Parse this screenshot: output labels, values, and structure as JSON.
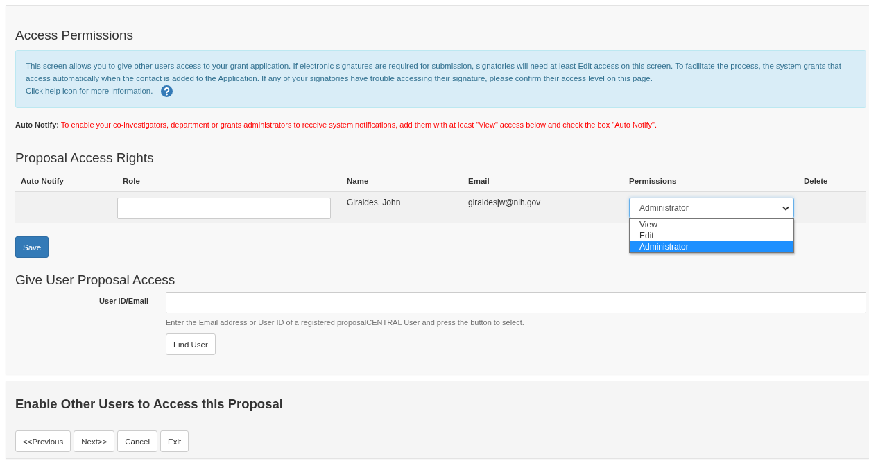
{
  "access_permissions": {
    "title": "Access Permissions",
    "info": "This screen allows you to give other users access to your grant application. If electronic signatures are required for submission, signatories will need at least Edit access on this screen. To facilitate the process, the system grants that access automatically when the contact is added to the Application. If any of your signatories have trouble accessing their signature, please confirm their access level on this page.",
    "help_text": "Click help icon for more information."
  },
  "auto_notify": {
    "label": "Auto Notify:",
    "text": "To enable your co-investigators, department or grants administrators to receive system notifications, add them with at least \"View\" access below and check the box \"Auto Notify\"."
  },
  "proposal_access_rights": {
    "title": "Proposal Access Rights",
    "columns": [
      "Auto Notify",
      "Role",
      "Name",
      "Email",
      "Permissions",
      "Delete"
    ],
    "rows": [
      {
        "name": "Giraldes, John",
        "email": "giraldesjw@nih.gov",
        "permission": {
          "value": "Administrator",
          "expanded": true,
          "options": [
            {
              "label": "View",
              "selected": false
            },
            {
              "label": "Edit",
              "selected": false
            },
            {
              "label": "Administrator",
              "selected": true
            }
          ]
        }
      }
    ],
    "save_button": "Save"
  },
  "give_user_access": {
    "title": "Give User Proposal Access",
    "field_label": "User ID/Email",
    "hint": "Enter the Email address or User ID of a registered proposalCENTRAL User and press the button to select.",
    "button": "Find User"
  },
  "footer": {
    "title": "Enable Other Users to Access this Proposal",
    "buttons": [
      "<<Previous",
      "Next>>",
      "Cancel",
      "Exit"
    ]
  }
}
